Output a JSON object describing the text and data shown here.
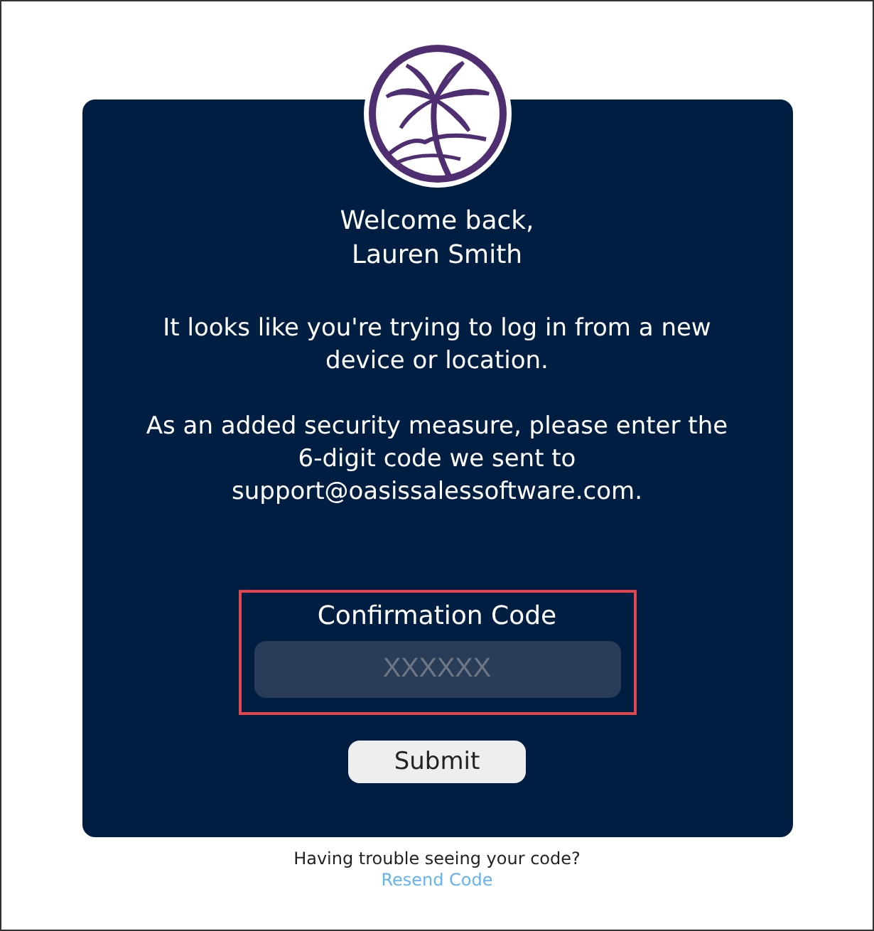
{
  "greeting": [
    "Welcome back,",
    "Lauren Smith"
  ],
  "paragraphs": [
    "It looks like you're trying to log in from a new device or location.",
    "As an added security measure, please enter the 6-digit code we sent to support@oasissalessoftware.com."
  ],
  "code_field": {
    "label": "Confirmation Code",
    "placeholder": "XXXXXX"
  },
  "submit_button": "Submit",
  "footer": {
    "text": "Having trouble seeing your code?",
    "link": "Resend Code"
  }
}
